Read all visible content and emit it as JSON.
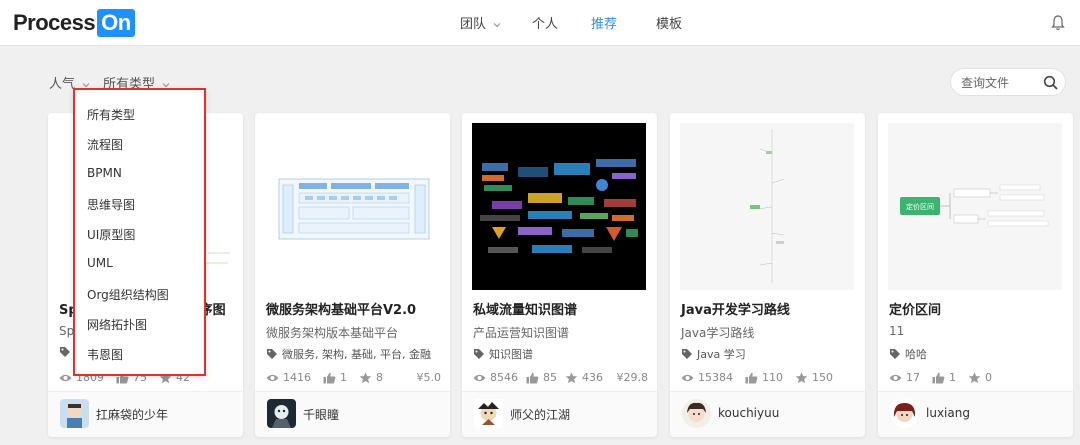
{
  "logo": {
    "part1": "Process",
    "part2": "On"
  },
  "nav": [
    {
      "label": "团队",
      "has_dropdown": true
    },
    {
      "label": "个人"
    },
    {
      "label": "推荐",
      "active": true
    },
    {
      "label": "模板"
    }
  ],
  "filters": {
    "sort_label": "人气",
    "type_label": "所有类型"
  },
  "search": {
    "placeholder": "查询文件"
  },
  "dropdown": {
    "items": [
      "所有类型",
      "流程图",
      "BPMN",
      "思维导图",
      "UI原型图",
      "UML",
      "Org组织结构图",
      "网络拓扑图",
      "韦恩图"
    ]
  },
  "cards": [
    {
      "title": "Sp",
      "title_tail": "序图",
      "subtitle": "Spr",
      "tags": "",
      "views": "1809",
      "likes": "75",
      "stars": "42",
      "price": "",
      "author": "扛麻袋的少年"
    },
    {
      "title": "微服务架构基础平台V2.0",
      "subtitle": "微服务架构版本基础平台",
      "tags": "微服务, 架构, 基础, 平台, 金融",
      "views": "1416",
      "likes": "1",
      "stars": "8",
      "price": "¥5.0",
      "author": "千眼瞳"
    },
    {
      "title": "私域流量知识图谱",
      "subtitle": "产品运营知识图谱",
      "tags": "知识图谱",
      "views": "8546",
      "likes": "85",
      "stars": "436",
      "price": "¥29.8",
      "author": "师父的江湖"
    },
    {
      "title": "Java开发学习路线",
      "subtitle": "Java学习路线",
      "tags": "Java 学习",
      "views": "15384",
      "likes": "110",
      "stars": "150",
      "price": "",
      "author": "kouchiyuu"
    },
    {
      "title": "定价区间",
      "subtitle": "11",
      "tags": "哈哈",
      "views": "17",
      "likes": "1",
      "stars": "0",
      "price": "",
      "author": "luxiang"
    }
  ],
  "thumb5": {
    "center": "定价区间"
  },
  "colors": {
    "accent": "#2f8ef4",
    "logo_blue": "#1e90ff",
    "highlight_border": "#e0312b"
  }
}
